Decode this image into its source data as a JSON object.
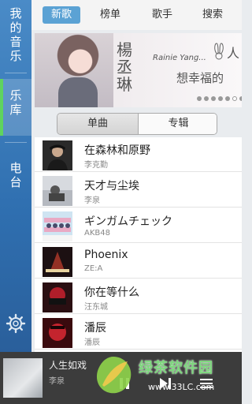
{
  "sidebar": {
    "mine_label": "我的音乐",
    "library_label": "乐库",
    "radio_label": "电台",
    "settings_icon": "gear-icon"
  },
  "tabs": [
    {
      "label": "新歌",
      "active": true
    },
    {
      "label": "榜单",
      "active": false
    },
    {
      "label": "歌手",
      "active": false
    },
    {
      "label": "搜索",
      "active": false
    }
  ],
  "banner": {
    "artist": "楊丞琳",
    "english": "Rainie Yang...",
    "title": "想幸福的",
    "title_end": "人",
    "dots_total": 7,
    "dots_active": 6
  },
  "segment": {
    "single_label": "单曲",
    "album_label": "专辑",
    "selected": "单曲"
  },
  "songs": [
    {
      "title": "在森林和原野",
      "artist": "李克勤"
    },
    {
      "title": "天才与尘埃",
      "artist": "李泉"
    },
    {
      "title": "ギンガムチェック",
      "artist": "AKB48"
    },
    {
      "title": "Phoenix",
      "artist": "ZE:A"
    },
    {
      "title": "你在等什么",
      "artist": "汪东城"
    },
    {
      "title": "潘辰",
      "artist": "潘辰"
    }
  ],
  "player": {
    "title": "人生如戏",
    "artist": "李泉"
  },
  "watermark": {
    "text": "绿茶软件园",
    "url": "www.33LC.com"
  },
  "colors": {
    "accent": "#5ba2d4",
    "sidebar": "#2f6fb0",
    "selected_indicator": "#5fd35f"
  }
}
